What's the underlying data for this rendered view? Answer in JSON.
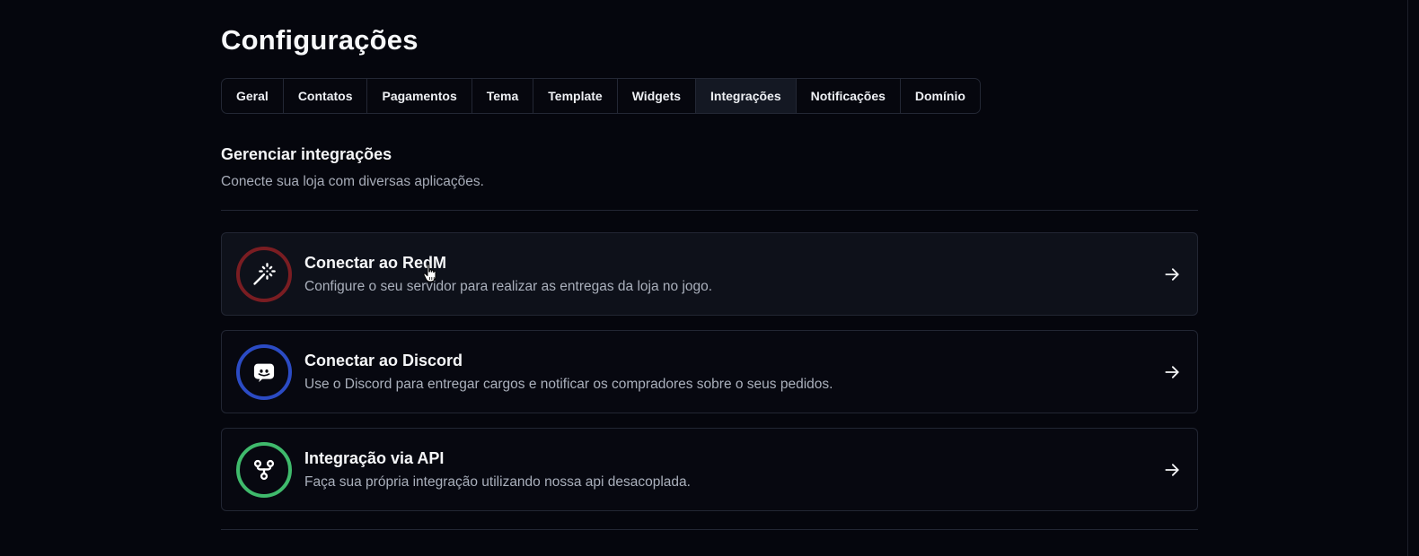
{
  "page": {
    "title": "Configurações"
  },
  "tabs": [
    {
      "label": "Geral"
    },
    {
      "label": "Contatos"
    },
    {
      "label": "Pagamentos"
    },
    {
      "label": "Tema"
    },
    {
      "label": "Template"
    },
    {
      "label": "Widgets"
    },
    {
      "label": "Integrações",
      "active": true
    },
    {
      "label": "Notificações"
    },
    {
      "label": "Domínio"
    }
  ],
  "section": {
    "title": "Gerenciar integrações",
    "description": "Conecte sua loja com diversas aplicações."
  },
  "integrations": [
    {
      "title": "Conectar ao RedM",
      "description": "Configure o seu servidor para realizar as entregas da loja no jogo.",
      "icon": "magic-wand-icon",
      "ring_color": "#7a1d22"
    },
    {
      "title": "Conectar ao Discord",
      "description": "Use o Discord para entregar cargos e notificar os compradores sobre o seus pedidos.",
      "icon": "discord-icon",
      "ring_color": "#2b4bc4"
    },
    {
      "title": "Integração via API",
      "description": "Faça sua própria integração utilizando nossa api desacoplada.",
      "icon": "git-fork-icon",
      "ring_color": "#3fba6c"
    }
  ]
}
